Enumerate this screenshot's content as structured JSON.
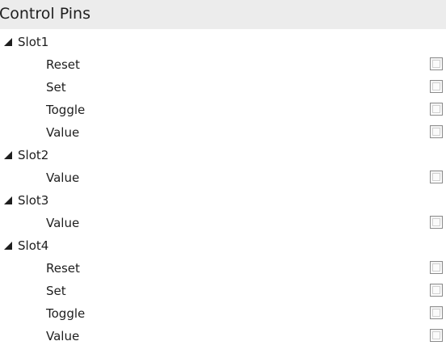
{
  "header": {
    "title": "Control Pins"
  },
  "slots": [
    {
      "label": "Slot1",
      "expanded": true,
      "pins": [
        {
          "label": "Reset",
          "checked": false
        },
        {
          "label": "Set",
          "checked": false
        },
        {
          "label": "Toggle",
          "checked": false
        },
        {
          "label": "Value",
          "checked": false
        }
      ]
    },
    {
      "label": "Slot2",
      "expanded": true,
      "pins": [
        {
          "label": "Value",
          "checked": false
        }
      ]
    },
    {
      "label": "Slot3",
      "expanded": true,
      "pins": [
        {
          "label": "Value",
          "checked": false
        }
      ]
    },
    {
      "label": "Slot4",
      "expanded": true,
      "pins": [
        {
          "label": "Reset",
          "checked": false
        },
        {
          "label": "Set",
          "checked": false
        },
        {
          "label": "Toggle",
          "checked": false
        },
        {
          "label": "Value",
          "checked": false
        }
      ]
    }
  ],
  "colors": {
    "header_background": "#ececec",
    "text": "#1e1e1e",
    "checkbox_border": "#8a8a8a"
  },
  "icons": {
    "expander": "expanded-triangle-icon"
  }
}
